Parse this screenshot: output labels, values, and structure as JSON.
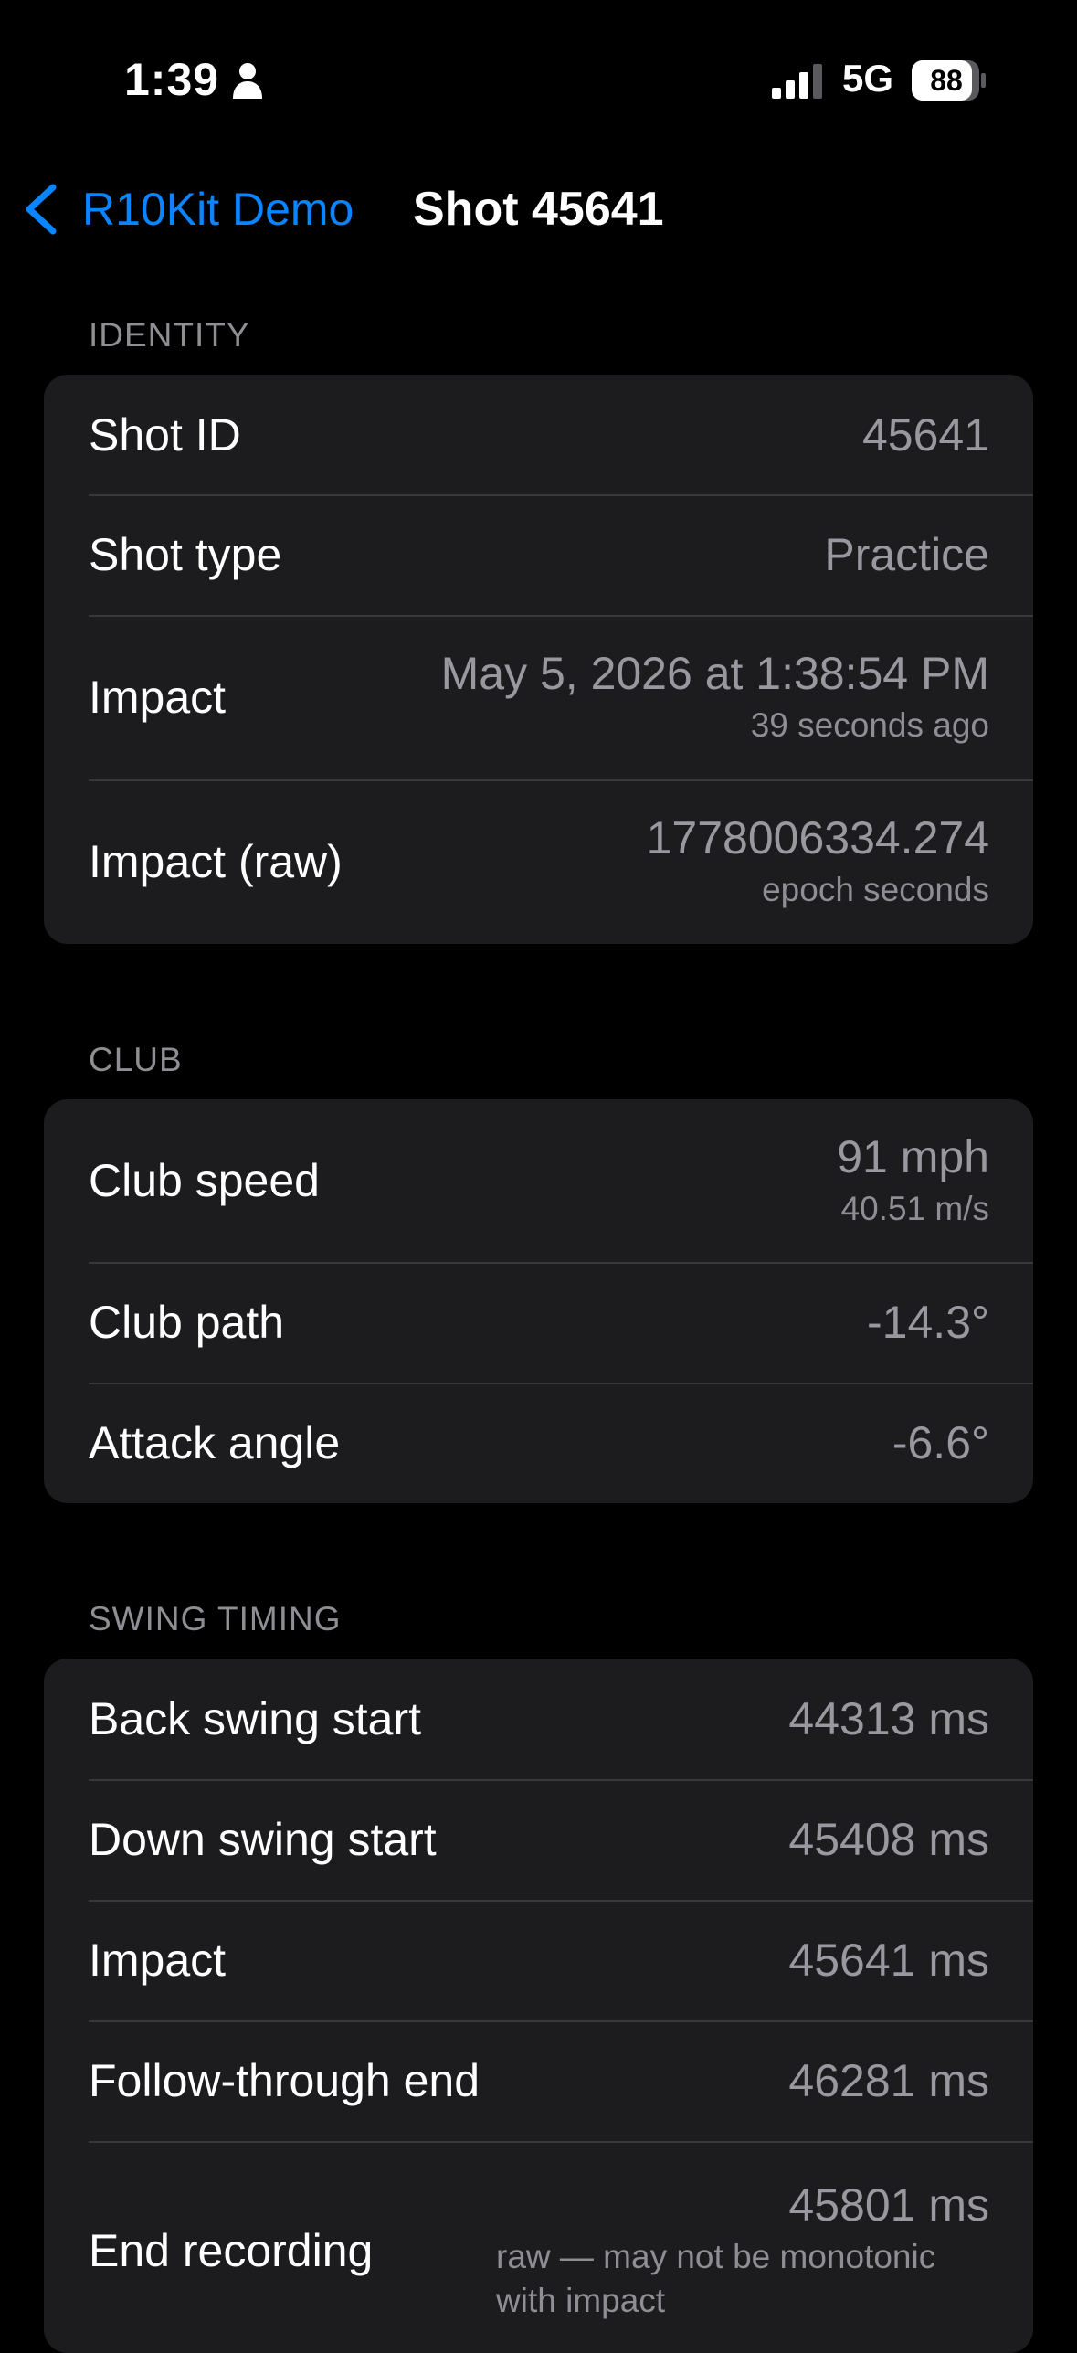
{
  "status_bar": {
    "time": "1:39",
    "network": "5G",
    "battery": "88",
    "icons": [
      "person-icon",
      "signal-icon",
      "battery-icon"
    ]
  },
  "nav": {
    "back_label": "R10Kit Demo",
    "title": "Shot 45641",
    "accent_color": "#0a84ff"
  },
  "identity": {
    "header": "IDENTITY",
    "rows": [
      {
        "label": "Shot ID",
        "value": "45641"
      },
      {
        "label": "Shot type",
        "value": "Practice"
      },
      {
        "label": "Impact",
        "value": "May 5, 2026 at 1:38:54 PM",
        "sub": "39 seconds ago"
      },
      {
        "label": "Impact (raw)",
        "value": "1778006334.274",
        "sub": "epoch seconds"
      }
    ]
  },
  "club": {
    "header": "CLUB",
    "rows": [
      {
        "label": "Club speed",
        "value": "91 mph",
        "sub": "40.51 m/s"
      },
      {
        "label": "Club path",
        "value": "-14.3°"
      },
      {
        "label": "Attack angle",
        "value": "-6.6°"
      }
    ]
  },
  "swing_timing": {
    "header": "SWING TIMING",
    "rows": [
      {
        "label": "Back swing start",
        "value": "44313 ms"
      },
      {
        "label": "Down swing start",
        "value": "45408 ms"
      },
      {
        "label": "Impact",
        "value": "45641 ms"
      },
      {
        "label": "Follow-through end",
        "value": "46281 ms"
      },
      {
        "label": "End recording",
        "value": "45801 ms",
        "sub": "raw — may not be monotonic with impact"
      }
    ]
  }
}
